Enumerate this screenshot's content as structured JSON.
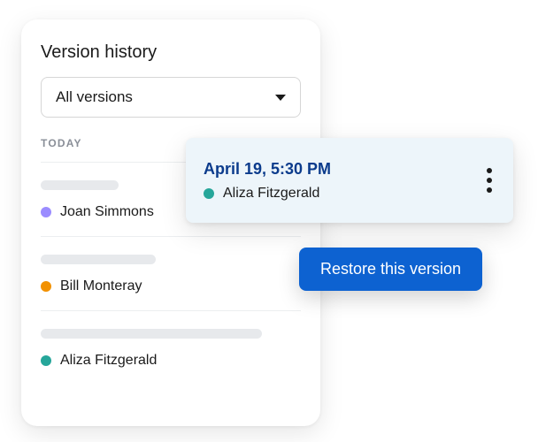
{
  "panel": {
    "title": "Version history",
    "dropdown": {
      "selected": "All versions"
    },
    "section_label": "TODAY",
    "items": [
      {
        "author": "Joan Simmons",
        "dot_color": "purple"
      },
      {
        "author": "Bill Monteray",
        "dot_color": "orange"
      },
      {
        "author": "Aliza Fitzgerald",
        "dot_color": "teal"
      }
    ]
  },
  "selected_version": {
    "timestamp": "April 19, 5:30 PM",
    "author": "Aliza Fitzgerald",
    "dot_color": "teal"
  },
  "restore_button": {
    "label": "Restore this version"
  }
}
